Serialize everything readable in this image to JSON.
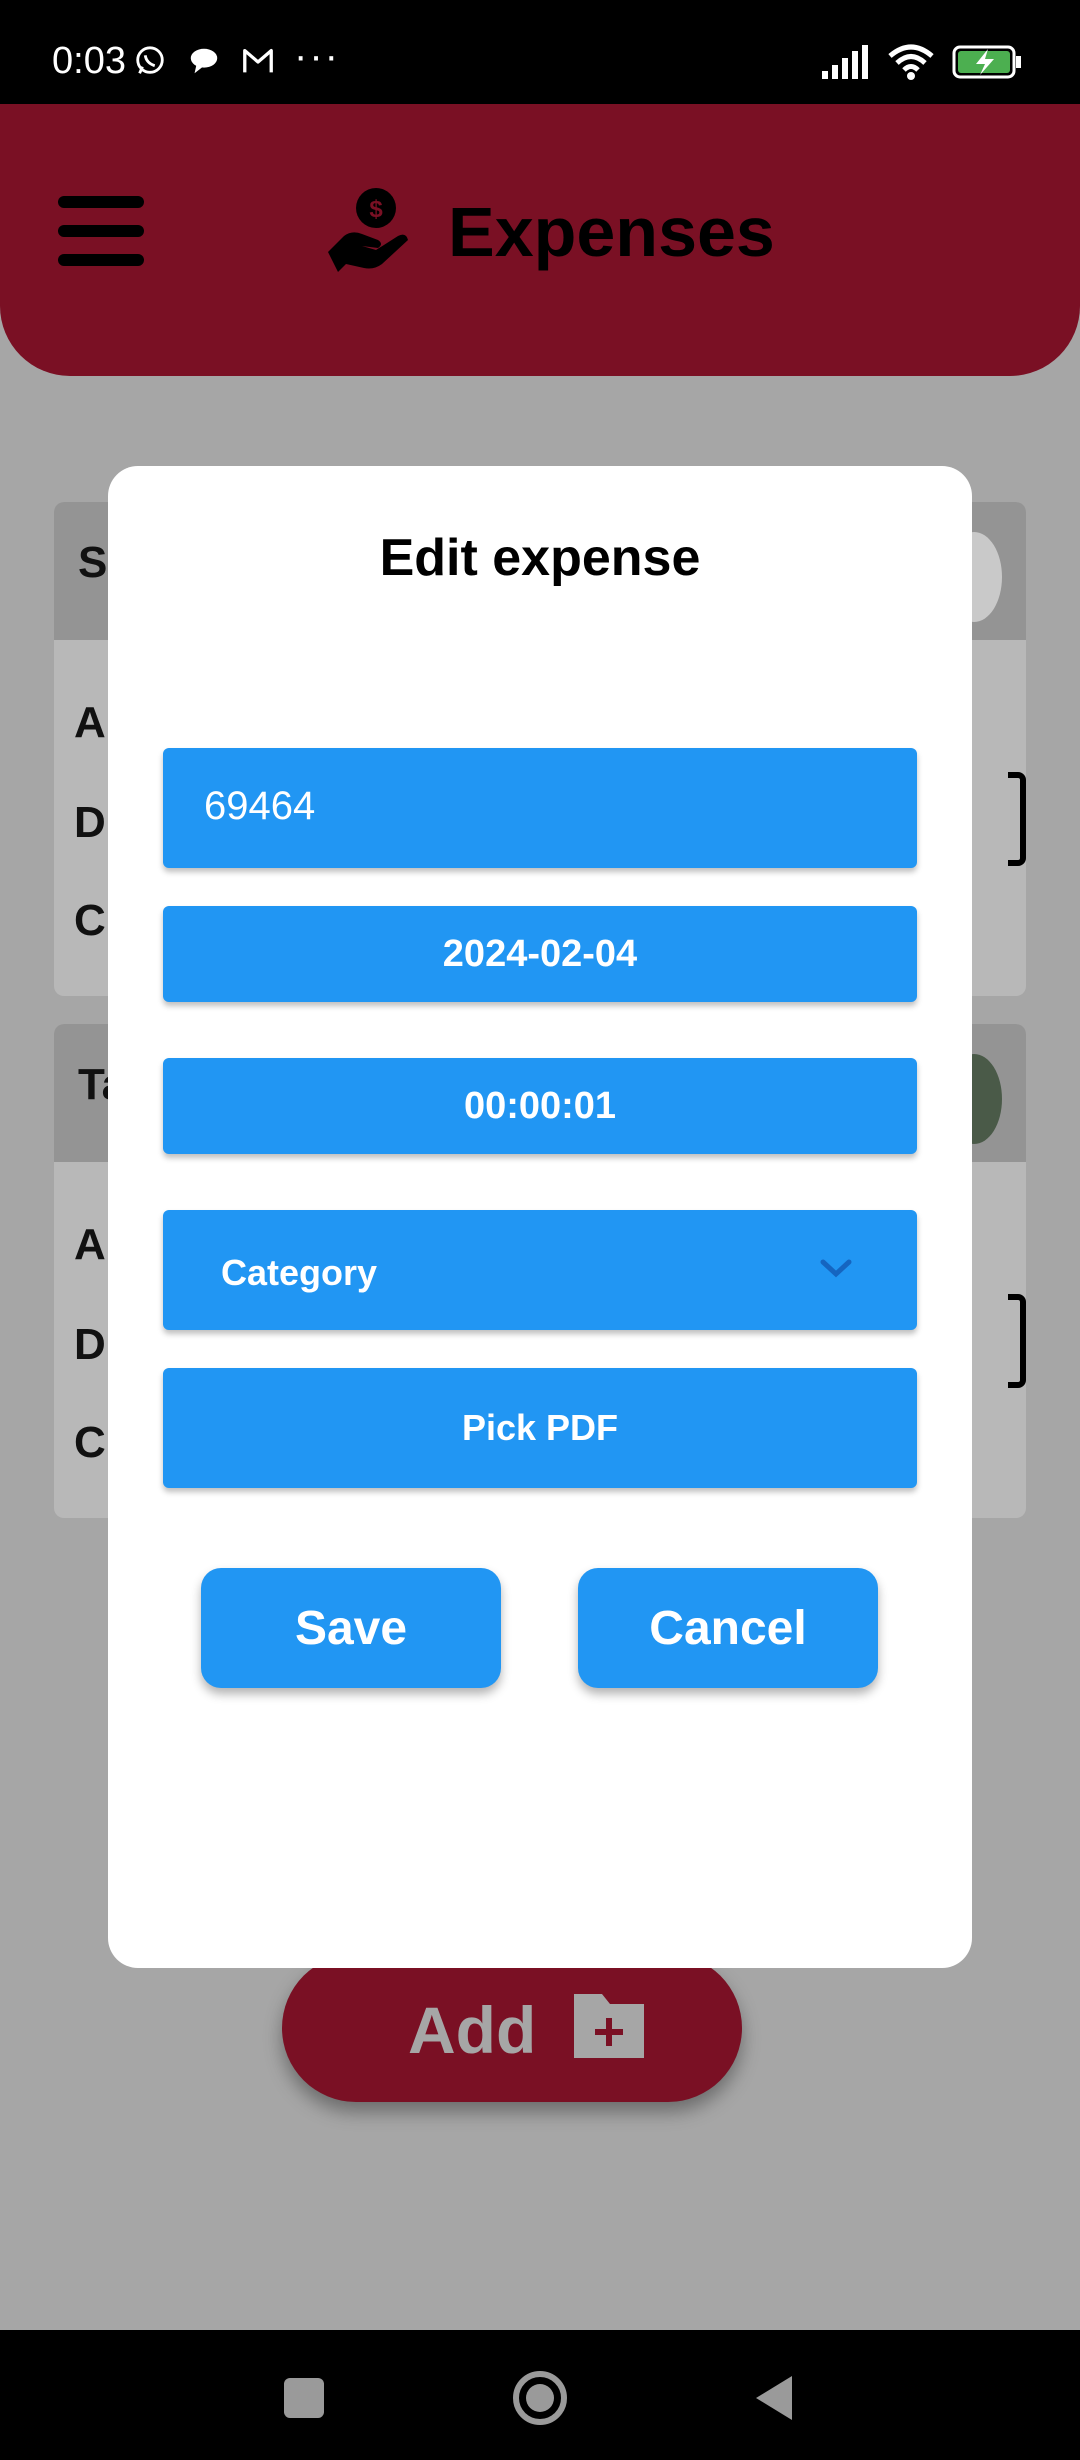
{
  "status_bar": {
    "time": "0:03",
    "left_icons": [
      "whatsapp-icon",
      "chat-bubble-icon",
      "gmail-icon"
    ],
    "more": "···",
    "right_icons": [
      "signal-icon",
      "wifi-icon",
      "battery-charging-icon"
    ]
  },
  "header": {
    "title": "Expenses",
    "menu_icon": "hamburger-menu-icon",
    "logo_icon": "money-hand-icon"
  },
  "background_cards": [
    {
      "letters": [
        "S",
        "A",
        "D",
        "C"
      ]
    },
    {
      "letters": [
        "Ta",
        "A",
        "D",
        "C"
      ]
    }
  ],
  "add_button": {
    "label": "Add",
    "icon": "add-folder-icon"
  },
  "dialog": {
    "title": "Edit expense",
    "amount_value": "69464",
    "date_value": "2024-02-04",
    "time_value": "00:00:01",
    "category_label": "Category",
    "pick_pdf_label": "Pick PDF",
    "save_label": "Save",
    "cancel_label": "Cancel"
  },
  "colors": {
    "brand": "#7a1024",
    "accent": "#2196f3",
    "overlay": "#a6a6a6"
  }
}
